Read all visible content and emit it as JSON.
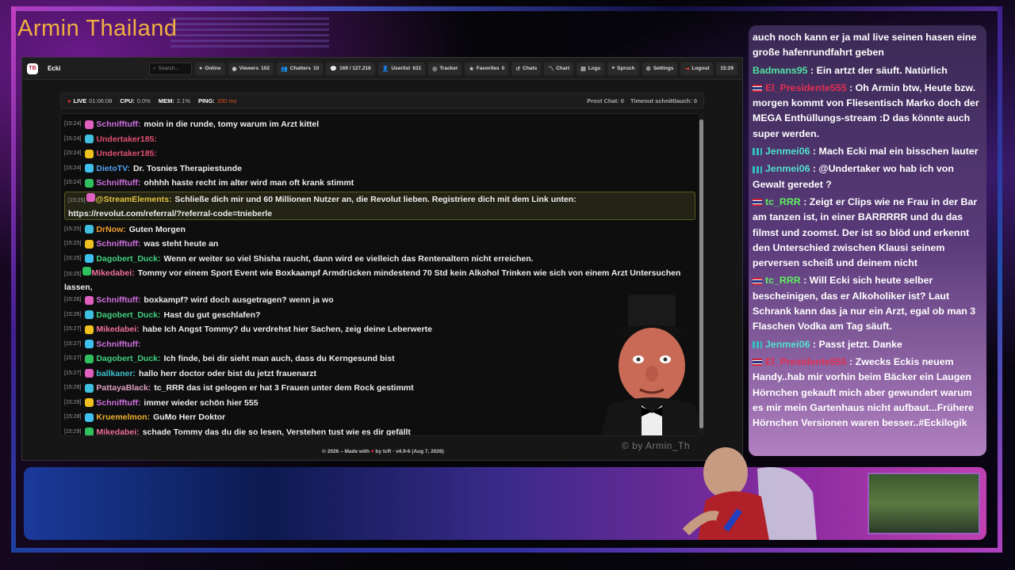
{
  "overlay": {
    "title": "Armin Thailand",
    "watermark": "© by Armin_Th"
  },
  "app": {
    "logo": "TB",
    "title": "Ecki",
    "search_placeholder": "Search...",
    "toolbar": {
      "online": "Online",
      "viewers": "Viewers",
      "viewers_count": "102",
      "chatters": "Chatters",
      "chatters_count": "10",
      "messages": "169 / 127.216",
      "userlist": "Userlist",
      "userlist_count": "631",
      "tracker": "Tracker",
      "favorites": "Favorites",
      "favorites_count": "0",
      "chats": "Chats",
      "chart": "Chart",
      "logs": "Logs",
      "spruch": "Spruch",
      "settings": "Settings",
      "logout": "Logout",
      "time": "15:29"
    },
    "status": {
      "live": "LIVE",
      "uptime": "01:06:08",
      "cpu_label": "CPU:",
      "cpu": "0.0%",
      "mem_label": "MEM:",
      "mem": "2.1%",
      "ping_label": "PING:",
      "ping": "200 ms",
      "prost": "Prost Chat: 0",
      "timeout": "Timeout schnittlauch: 0"
    },
    "footer": {
      "pre": "© 2026 – Made with",
      "post": "by tcR · v4.9-6 (Aug 7, 2026)"
    }
  },
  "chat": [
    {
      "time": "[15:24]",
      "user": "Schnifftuff",
      "color": "#d070e0",
      "text": "moin in die runde, tomy warum im Arzt kittel"
    },
    {
      "time": "[15:24]",
      "user": "Undertaker185",
      "color": "#e05070",
      "text": ""
    },
    {
      "time": "[15:24]",
      "user": "Undertaker185",
      "color": "#e05070",
      "text": ""
    },
    {
      "time": "[15:24]",
      "user": "DietoTV",
      "color": "#50a0f0",
      "text": "Dr. Tosnies Therapiestunde"
    },
    {
      "time": "[15:24]",
      "user": "Schnifftuff",
      "color": "#d070e0",
      "text": "ohhhh haste recht im alter wird man oft krank stimmt"
    },
    {
      "time": "[15:25]",
      "user": "@StreamElements",
      "color": "#e0c040",
      "text": "Schließe dich mir und 60 Millionen Nutzer an, die Revolut lieben. Registriere dich mit dem Link unten: https://revolut.com/referral/?referral-code=tnieberle"
    },
    {
      "time": "[15:25]",
      "user": "DrNow",
      "color": "#f0a030",
      "text": "Guten Morgen"
    },
    {
      "time": "[15:25]",
      "user": "Schnifftuff",
      "color": "#d070e0",
      "text": "was steht heute an"
    },
    {
      "time": "[15:25]",
      "user": "Dagobert_Duck",
      "color": "#40d080",
      "text": "Wenn er weiter so viel Shisha raucht, dann wird ee vielleich das Rentenaltern nicht erreichen."
    },
    {
      "time": "[15:25]",
      "user": "Mikedabei",
      "color": "#f070a0",
      "text": "Tommy vor einem Sport Event wie Boxkaampf Armdrücken mindestend 70 Std kein Alkohol Trinken wie sich von einem Arzt Untersuchen lassen,"
    },
    {
      "time": "[15:26]",
      "user": "Schnifftuff",
      "color": "#d070e0",
      "text": "boxkampf? wird doch ausgetragen? wenn ja wo"
    },
    {
      "time": "[15:26]",
      "user": "Dagobert_Duck",
      "color": "#40d080",
      "text": "Hast du gut geschlafen?"
    },
    {
      "time": "[15:27]",
      "user": "Mikedabei",
      "color": "#f070a0",
      "text": "habe Ich Angst Tommy? du verdrehst hier Sachen, zeig deine Leberwerte"
    },
    {
      "time": "[15:27]",
      "user": "Schnifftuff",
      "color": "#d070e0",
      "text": ""
    },
    {
      "time": "[15:27]",
      "user": "Dagobert_Duck",
      "color": "#40d080",
      "text": "Ich finde, bei dir sieht man auch, dass du Kerngesund bist"
    },
    {
      "time": "[15:27]",
      "user": "ballkaner",
      "color": "#40c0d0",
      "text": "hallo herr doctor oder bist du jetzt frauenarzt"
    },
    {
      "time": "[15:28]",
      "user": "PattayaBlack",
      "color": "#e0a0c0",
      "text": "tc_RRR das ist gelogen er hat 3 Frauen unter dem Rock gestimmt"
    },
    {
      "time": "[15:28]",
      "user": "Schnifftuff",
      "color": "#d070e0",
      "text": "immer wieder schön hier 555"
    },
    {
      "time": "[15:28]",
      "user": "Kruemelmon",
      "color": "#f0b030",
      "text": "GuMo Herr Doktor"
    },
    {
      "time": "[15:29]",
      "user": "Mikedabei",
      "color": "#f070a0",
      "text": "schade Tommy das du die so lesen, Verstehen tust wie es dir gefällt"
    }
  ],
  "overlay_chat": [
    {
      "user": "",
      "color": "#ffffff",
      "flag": "",
      "text": "auch noch kann er ja mal live seinen hasen eine große hafenrundfahrt geben"
    },
    {
      "user": "Badmans95",
      "color": "#50e0a0",
      "flag": "",
      "text": ": Ein artzt der säuft. Natürlich"
    },
    {
      "user": "El_Presidente555",
      "color": "#e03050",
      "flag": "th",
      "text": ": Oh Armin btw, Heute bzw. morgen kommt von Fliesentisch Marko doch der MEGA Enthüllungs-stream :D das könnte auch super werden."
    },
    {
      "user": "Jenmei06",
      "color": "#50e0d0",
      "flag": "pipe",
      "text": ": Mach Ecki mal ein bisschen lauter"
    },
    {
      "user": "Jenmei06",
      "color": "#50e0d0",
      "flag": "pipe",
      "text": ": @Undertaker wo hab ich von Gewalt geredet ?"
    },
    {
      "user": "tc_RRR",
      "color": "#60f060",
      "flag": "th",
      "text": ": Zeigt er Clips wie ne Frau in der Bar am tanzen ist, in einer BARRRRR und du das filmst und zoomst. Der ist so blöd und erkennt den Unterschied zwischen Klausi seinem perversen scheiß und deinem nicht"
    },
    {
      "user": "tc_RRR",
      "color": "#60f060",
      "flag": "th",
      "text": ": Will Ecki sich heute selber bescheinigen, das er Alkoholiker ist? Laut Schrank kann das ja nur ein Arzt, egal ob man 3 Flaschen Vodka am Tag säuft."
    },
    {
      "user": "Jenmei06",
      "color": "#50e0d0",
      "flag": "pipe",
      "text": ": Passt jetzt. Danke"
    },
    {
      "user": "El_Presidente555",
      "color": "#e03050",
      "flag": "th",
      "text": ": Zwecks Eckis neuem Handy..hab mir vorhin beim Bäcker ein Laugen Hörnchen gekauft mich aber gewundert warum es mir mein Gartenhaus nicht aufbaut...Frühere Hörnchen Versionen waren besser..#Eckilogik"
    }
  ]
}
